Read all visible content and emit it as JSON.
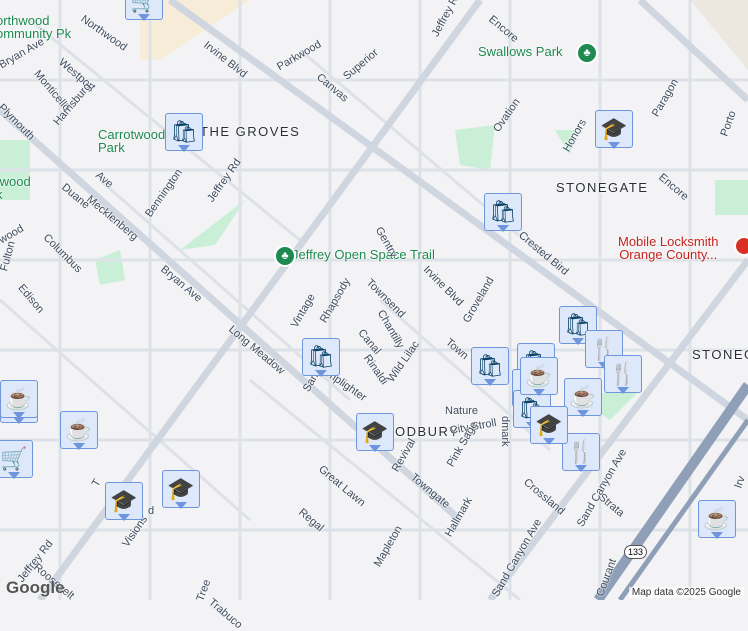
{
  "labels": {
    "areas": [
      "THE GROVES",
      "STONEGATE",
      "STONEGATE",
      "ODBURY"
    ],
    "parks": [
      "orthwood\nommunity Pk",
      "Carrotwood\nPark",
      "twood\nk",
      "Swallows Park",
      "Jeffrey Open Space Trail"
    ],
    "poi": "Mobile Locksmith\nOrange County...",
    "streets": [
      "Northwood",
      "Irvine Blvd",
      "Parkwood",
      "Canvas",
      "Superior",
      "Jeffrey Rd",
      "Encore",
      "Westport",
      "Monticello",
      "Plymouth",
      "Harrisburg",
      "Ave",
      "Mecklenberg",
      "Bennington",
      "Duane",
      "Bryan Ave",
      "Bryan Ave",
      "Columbus",
      "Fulton",
      "Edison",
      "wood",
      "Jeffrey Rd",
      "Gentry",
      "Irvine Blvd",
      "Townsend",
      "Chantilly",
      "Canal",
      "Rhapsody",
      "Vintage",
      "Long Meadow",
      "Rinaldi",
      "Lamplighter",
      "Wild Lilac",
      "Groveland",
      "Town",
      "Sanctuary",
      "Nature",
      "City Stroll",
      "Pink Sage",
      "dmark",
      "Revival",
      "Towngate",
      "Great Lawn",
      "Regal",
      "Crossland",
      "Strata",
      "Sand Canyon Ave",
      "Sand Canyon Ave",
      "Hallmark",
      "Mapleton",
      "Courant",
      "Roosevelt",
      "Visions",
      "Trabuco",
      "Tree",
      "Ovation",
      "Honors",
      "Paragon",
      "Porto",
      "Encore",
      "Crested Bird",
      "Jeffrey Rd",
      "Irv",
      "T",
      "d"
    ]
  },
  "pins": [
    "cart",
    "bag",
    "bag",
    "bag",
    "bag",
    "bag",
    "bag",
    "bag",
    "bag",
    "fork",
    "fork",
    "fork",
    "cup",
    "cup",
    "cup",
    "cup",
    "grad",
    "grad",
    "grad",
    "grad",
    "grad",
    "grad",
    "cart",
    "cup"
  ],
  "pin_icons": {
    "cart": "🛒",
    "bag": "🛍",
    "fork": "🍴",
    "cup": "☕",
    "grad": "🎓"
  },
  "highway_shield": "133",
  "logo": "Google",
  "attribution": "Map data ©2025 Google"
}
